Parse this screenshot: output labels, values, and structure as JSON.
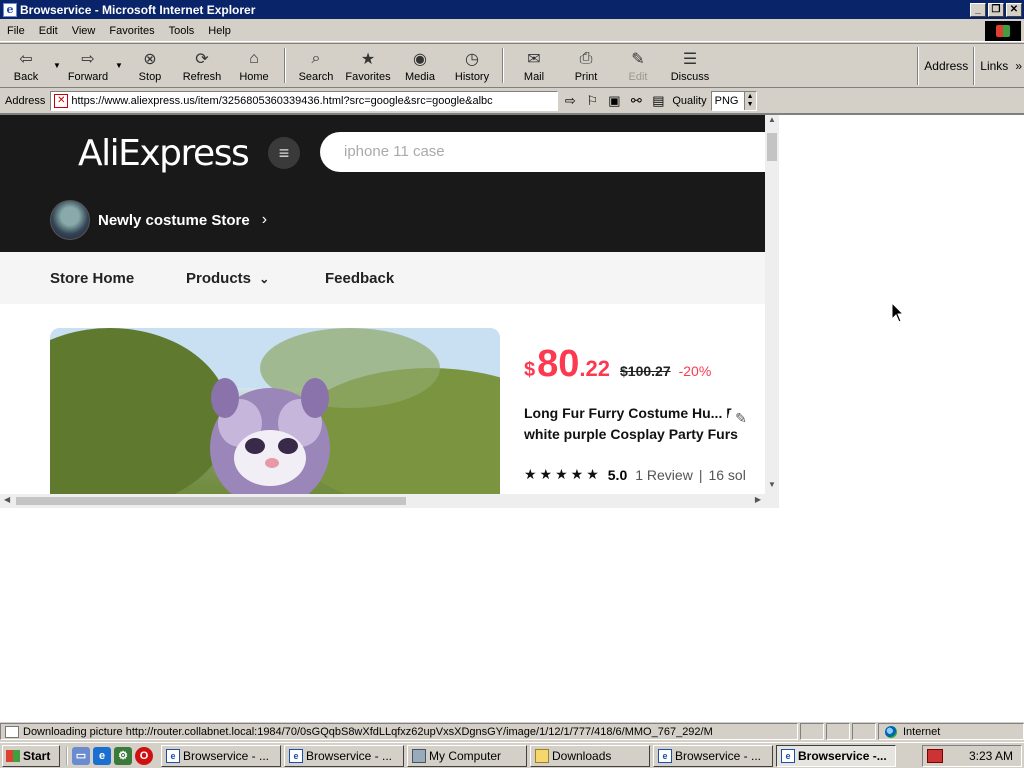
{
  "window": {
    "title": "Browservice - Microsoft Internet Explorer"
  },
  "menu": [
    "File",
    "Edit",
    "View",
    "Favorites",
    "Tools",
    "Help"
  ],
  "toolbar": {
    "back": "Back",
    "forward": "Forward",
    "stop": "Stop",
    "refresh": "Refresh",
    "home": "Home",
    "search": "Search",
    "favorites": "Favorites",
    "media": "Media",
    "history": "History",
    "mail": "Mail",
    "print": "Print",
    "edit": "Edit",
    "discuss": "Discuss",
    "address": "Address",
    "links": "Links"
  },
  "addressbar": {
    "label": "Address",
    "url": "https://www.aliexpress.us/item/3256805360339436.html?src=google&src=google&albc",
    "quality_label": "Quality",
    "quality_value": "PNG"
  },
  "page": {
    "logo": "AliExpress",
    "search_placeholder": "iphone 11 case",
    "store_name": "Newly costume Store",
    "nav": [
      "Store Home",
      "Products",
      "Feedback"
    ],
    "price": {
      "currency": "$",
      "integer": "80",
      "decimal": ".22",
      "original": "$100.27",
      "discount": "-20%"
    },
    "product_title_line1": "Long Fur Furry Costume Hu... D",
    "product_title_line2": "white purple Cosplay Party Furs",
    "rating": {
      "stars": 5,
      "score": "5.0",
      "reviews": "1 Review",
      "sold": "16 sol"
    }
  },
  "status": {
    "text": "Downloading picture http://router.collabnet.local:1984/70/0sGQqbS8wXfdLLqfxz62upVxsXDgnsGY/image/1/12/1/777/418/6/MMO_767_292/M",
    "zone": "Internet"
  },
  "taskbar": {
    "start": "Start",
    "tasks": [
      "Browservice - ...",
      "Browservice - ...",
      "My Computer",
      "Downloads",
      "Browservice - ...",
      "Browservice -..."
    ],
    "clock": "3:23 AM"
  }
}
